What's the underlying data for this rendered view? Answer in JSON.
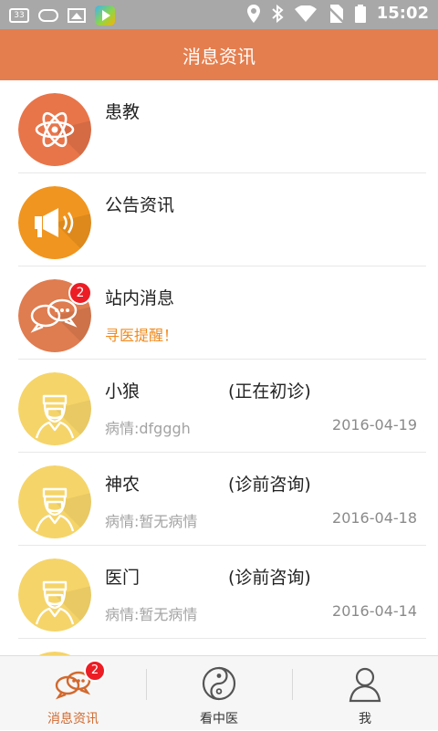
{
  "status_bar": {
    "sim_label": "33",
    "time": "15:02",
    "icons": [
      "sim-icon",
      "cloud-icon",
      "image-icon",
      "play-store-icon",
      "location-icon",
      "bluetooth-icon",
      "wifi-icon",
      "no-sim-icon",
      "battery-icon"
    ]
  },
  "header": {
    "title": "消息资讯"
  },
  "list": {
    "system_items": [
      {
        "title": "患教",
        "subtitle": "",
        "icon": "atom-icon",
        "color": "#e8754a"
      },
      {
        "title": "公告资讯",
        "subtitle": "",
        "icon": "megaphone-icon",
        "color": "#f0951f"
      },
      {
        "title": "站内消息",
        "subtitle": "寻医提醒！",
        "icon": "chat-bubbles-icon",
        "color": "#df7c50",
        "badge": "2"
      }
    ],
    "doctor_items": [
      {
        "name": "小狼",
        "status": "(正在初诊)",
        "condition": "病情:dfgggh",
        "date": "2016-04-19"
      },
      {
        "name": "神农",
        "status": "(诊前咨询)",
        "condition": "病情:暂无病情",
        "date": "2016-04-18"
      },
      {
        "name": "医门",
        "status": "(诊前咨询)",
        "condition": "病情:暂无病情",
        "date": "2016-04-14"
      }
    ],
    "doctor_avatar_color": "#f5d469"
  },
  "tab_bar": {
    "tabs": [
      {
        "label": "消息资讯",
        "icon": "chat-bubbles-icon",
        "active": true,
        "badge": "2"
      },
      {
        "label": "看中医",
        "icon": "yin-yang-icon",
        "active": false
      },
      {
        "label": "我",
        "icon": "person-icon",
        "active": false
      }
    ],
    "active_color": "#d2692e"
  }
}
